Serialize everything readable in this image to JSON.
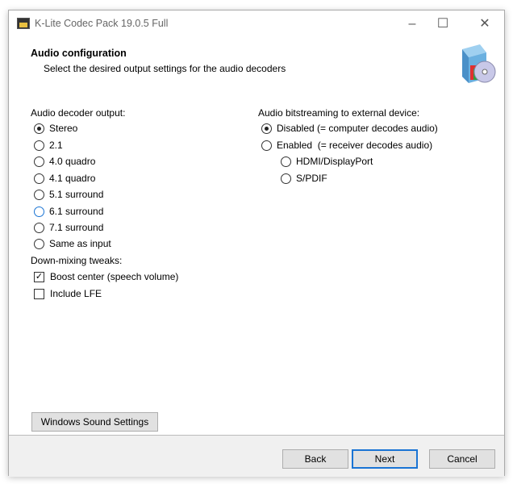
{
  "window": {
    "title": "K-Lite Codec Pack 19.0.5 Full"
  },
  "header": {
    "title": "Audio configuration",
    "subtitle": "Select the desired output settings for the audio decoders"
  },
  "decoder": {
    "label": "Audio decoder output:",
    "options": [
      "Stereo",
      "2.1",
      "4.0 quadro",
      "4.1 quadro",
      "5.1 surround",
      "6.1 surround",
      "7.1 surround",
      "Same as input"
    ],
    "selected": "Stereo"
  },
  "downmix": {
    "label": "Down-mixing tweaks:",
    "boost_center": {
      "label": "Boost center (speech volume)",
      "checked": true
    },
    "include_lfe": {
      "label": "Include LFE",
      "checked": false
    }
  },
  "bitstream": {
    "label": "Audio bitstreaming to external device:",
    "disabled": "Disabled (= computer decodes audio)",
    "enabled": "Enabled  (= receiver decodes audio)",
    "hdmi": "HDMI/DisplayPort",
    "spdif": "S/PDIF",
    "selected": "Disabled"
  },
  "buttons": {
    "sound_settings": "Windows Sound Settings",
    "back": "Back",
    "next": "Next",
    "cancel": "Cancel"
  }
}
